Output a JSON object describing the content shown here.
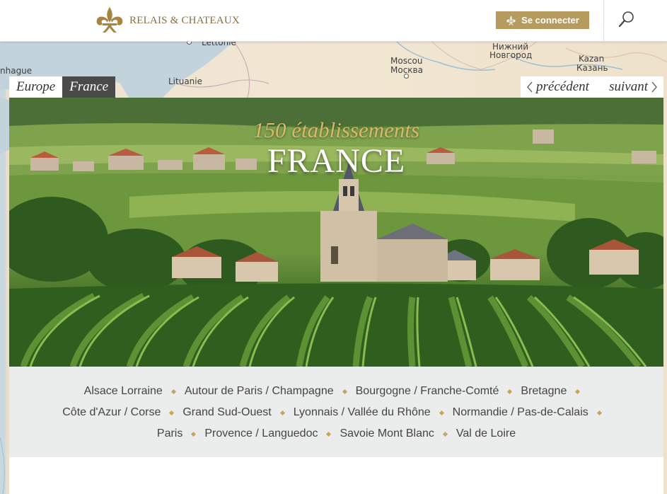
{
  "header": {
    "brand": "RELAIS & CHATEAUX",
    "login_label": "Se connecter"
  },
  "map": {
    "labels": [
      "Lettonie",
      "Lituanie",
      "Moscou",
      "Москва",
      "Нижний",
      "Новгород",
      "Kazan",
      "Казань",
      "nhague"
    ]
  },
  "breadcrumb": {
    "items": [
      "Europe",
      "France"
    ]
  },
  "pager": {
    "prev": "précédent",
    "next": "suivant"
  },
  "hero": {
    "count": "150 établissements",
    "title": "FRANCE"
  },
  "regions": {
    "rows": [
      [
        "Alsace Lorraine",
        "Autour de Paris / Champagne",
        "Bourgogne / Franche-Comté",
        "Bretagne"
      ],
      [
        "Côte d'Azur / Corse",
        "Grand Sud-Ouest",
        "Lyonnais / Vallée du Rhône",
        "Normandie / Pas-de-Calais"
      ],
      [
        "Paris",
        "Provence / Languedoc",
        "Savoie Mont Blanc",
        "Val de Loire"
      ]
    ]
  },
  "colors": {
    "brand_gold": "#b79a5e",
    "crumb_active": "#4a4a4a",
    "hero_count": "#d8b86a",
    "diamond": "#c9a45a"
  }
}
